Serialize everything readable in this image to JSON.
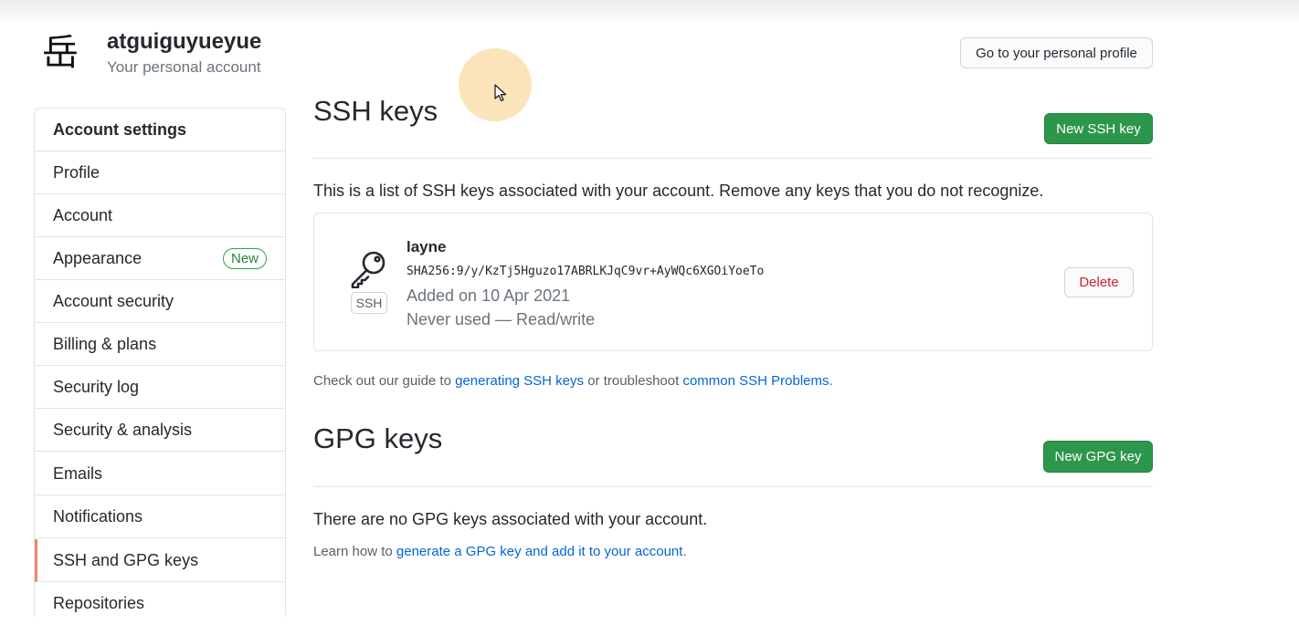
{
  "account": {
    "avatar_glyph": "岳",
    "name": "atguiguyueyue",
    "subtitle": "Your personal account",
    "profile_button": "Go to your personal profile"
  },
  "sidebar": {
    "header": "Account settings",
    "items": [
      {
        "label": "Profile"
      },
      {
        "label": "Account"
      },
      {
        "label": "Appearance",
        "badge": "New"
      },
      {
        "label": "Account security"
      },
      {
        "label": "Billing & plans"
      },
      {
        "label": "Security log"
      },
      {
        "label": "Security & analysis"
      },
      {
        "label": "Emails"
      },
      {
        "label": "Notifications"
      },
      {
        "label": "SSH and GPG keys",
        "selected": true
      },
      {
        "label": "Repositories"
      }
    ]
  },
  "ssh": {
    "title": "SSH keys",
    "new_button": "New SSH key",
    "intro": "This is a list of SSH keys associated with your account. Remove any keys that you do not recognize.",
    "key": {
      "type_label": "SSH",
      "title": "layne",
      "fingerprint": "SHA256:9/y/KzTj5Hguzo17ABRLKJqC9vr+AyWQc6XGOiYoeTo",
      "added": "Added on 10 Apr 2021",
      "usage": "Never used — Read/write",
      "delete_button": "Delete"
    },
    "help": {
      "prefix": "Check out our guide to",
      "link1": "generating SSH keys",
      "middle": "or troubleshoot",
      "link2": "common SSH Problems",
      "suffix": "."
    }
  },
  "gpg": {
    "title": "GPG keys",
    "new_button": "New GPG key",
    "empty_text": "There are no GPG keys associated with your account.",
    "help": {
      "prefix": "Learn how to",
      "link": "generate a GPG key and add it to your account",
      "suffix": "."
    }
  },
  "colors": {
    "primary_green": "#2c974b",
    "link_blue": "#0366d6",
    "danger_red": "#cb2431",
    "selected_accent": "#f9826c"
  }
}
